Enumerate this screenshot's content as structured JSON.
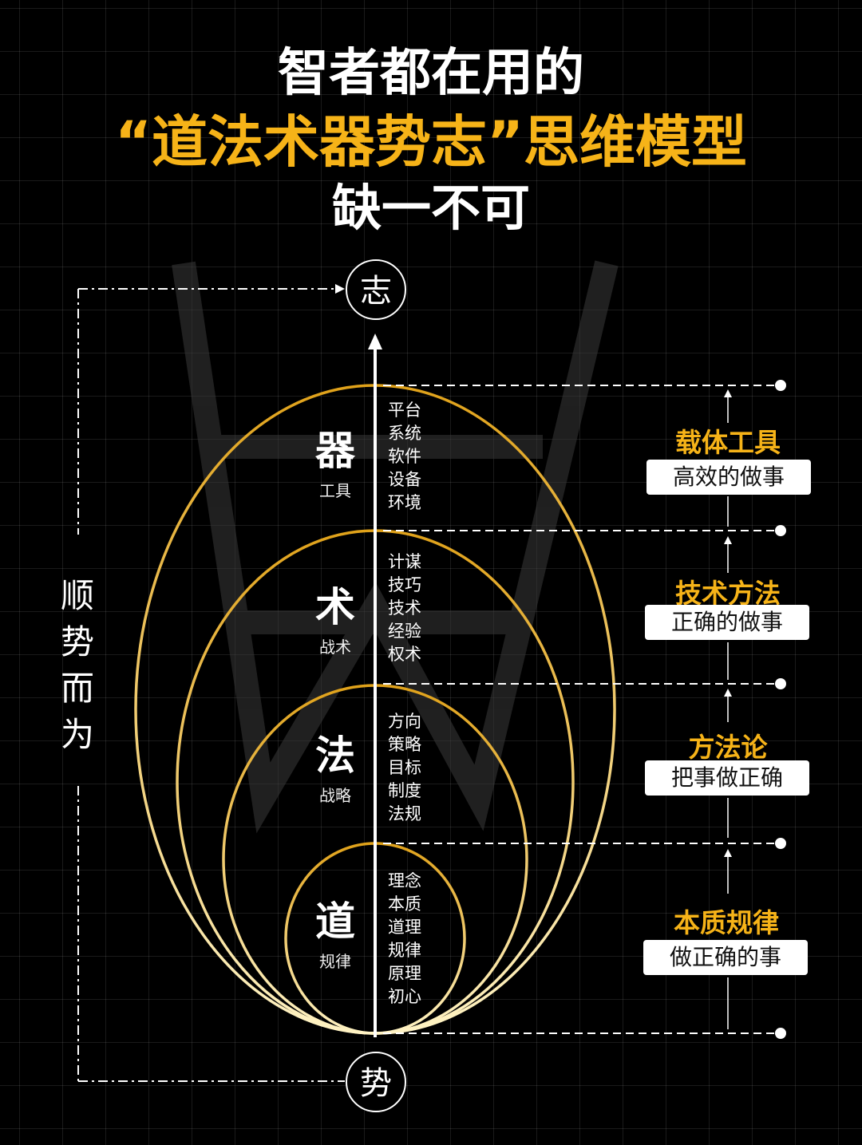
{
  "title": {
    "line1": "智者都在用的",
    "line2": "“道法术器势志”思维模型",
    "line3": "缺一不可"
  },
  "top_node": "志",
  "bottom_node": "势",
  "side_label": [
    "顺",
    "势",
    "而",
    "为"
  ],
  "levels": [
    {
      "name": "器",
      "sub": "工具",
      "items": [
        "平台",
        "系统",
        "软件",
        "设备",
        "环境"
      ],
      "category": "载体工具",
      "box": "高效的做事"
    },
    {
      "name": "术",
      "sub": "战术",
      "items": [
        "计谋",
        "技巧",
        "技术",
        "经验",
        "权术"
      ],
      "category": "技术方法",
      "box": "正确的做事"
    },
    {
      "name": "法",
      "sub": "战略",
      "items": [
        "方向",
        "策略",
        "目标",
        "制度",
        "法规"
      ],
      "category": "方法论",
      "box": "把事做正确"
    },
    {
      "name": "道",
      "sub": "规律",
      "items": [
        "理念",
        "本质",
        "道理",
        "规律",
        "原理",
        "初心"
      ],
      "category": "本质规律",
      "box": "做正确的事"
    }
  ],
  "colors": {
    "accent": "#f6b318",
    "background": "#000000",
    "grid": "#333333",
    "line": "#ffffff"
  }
}
